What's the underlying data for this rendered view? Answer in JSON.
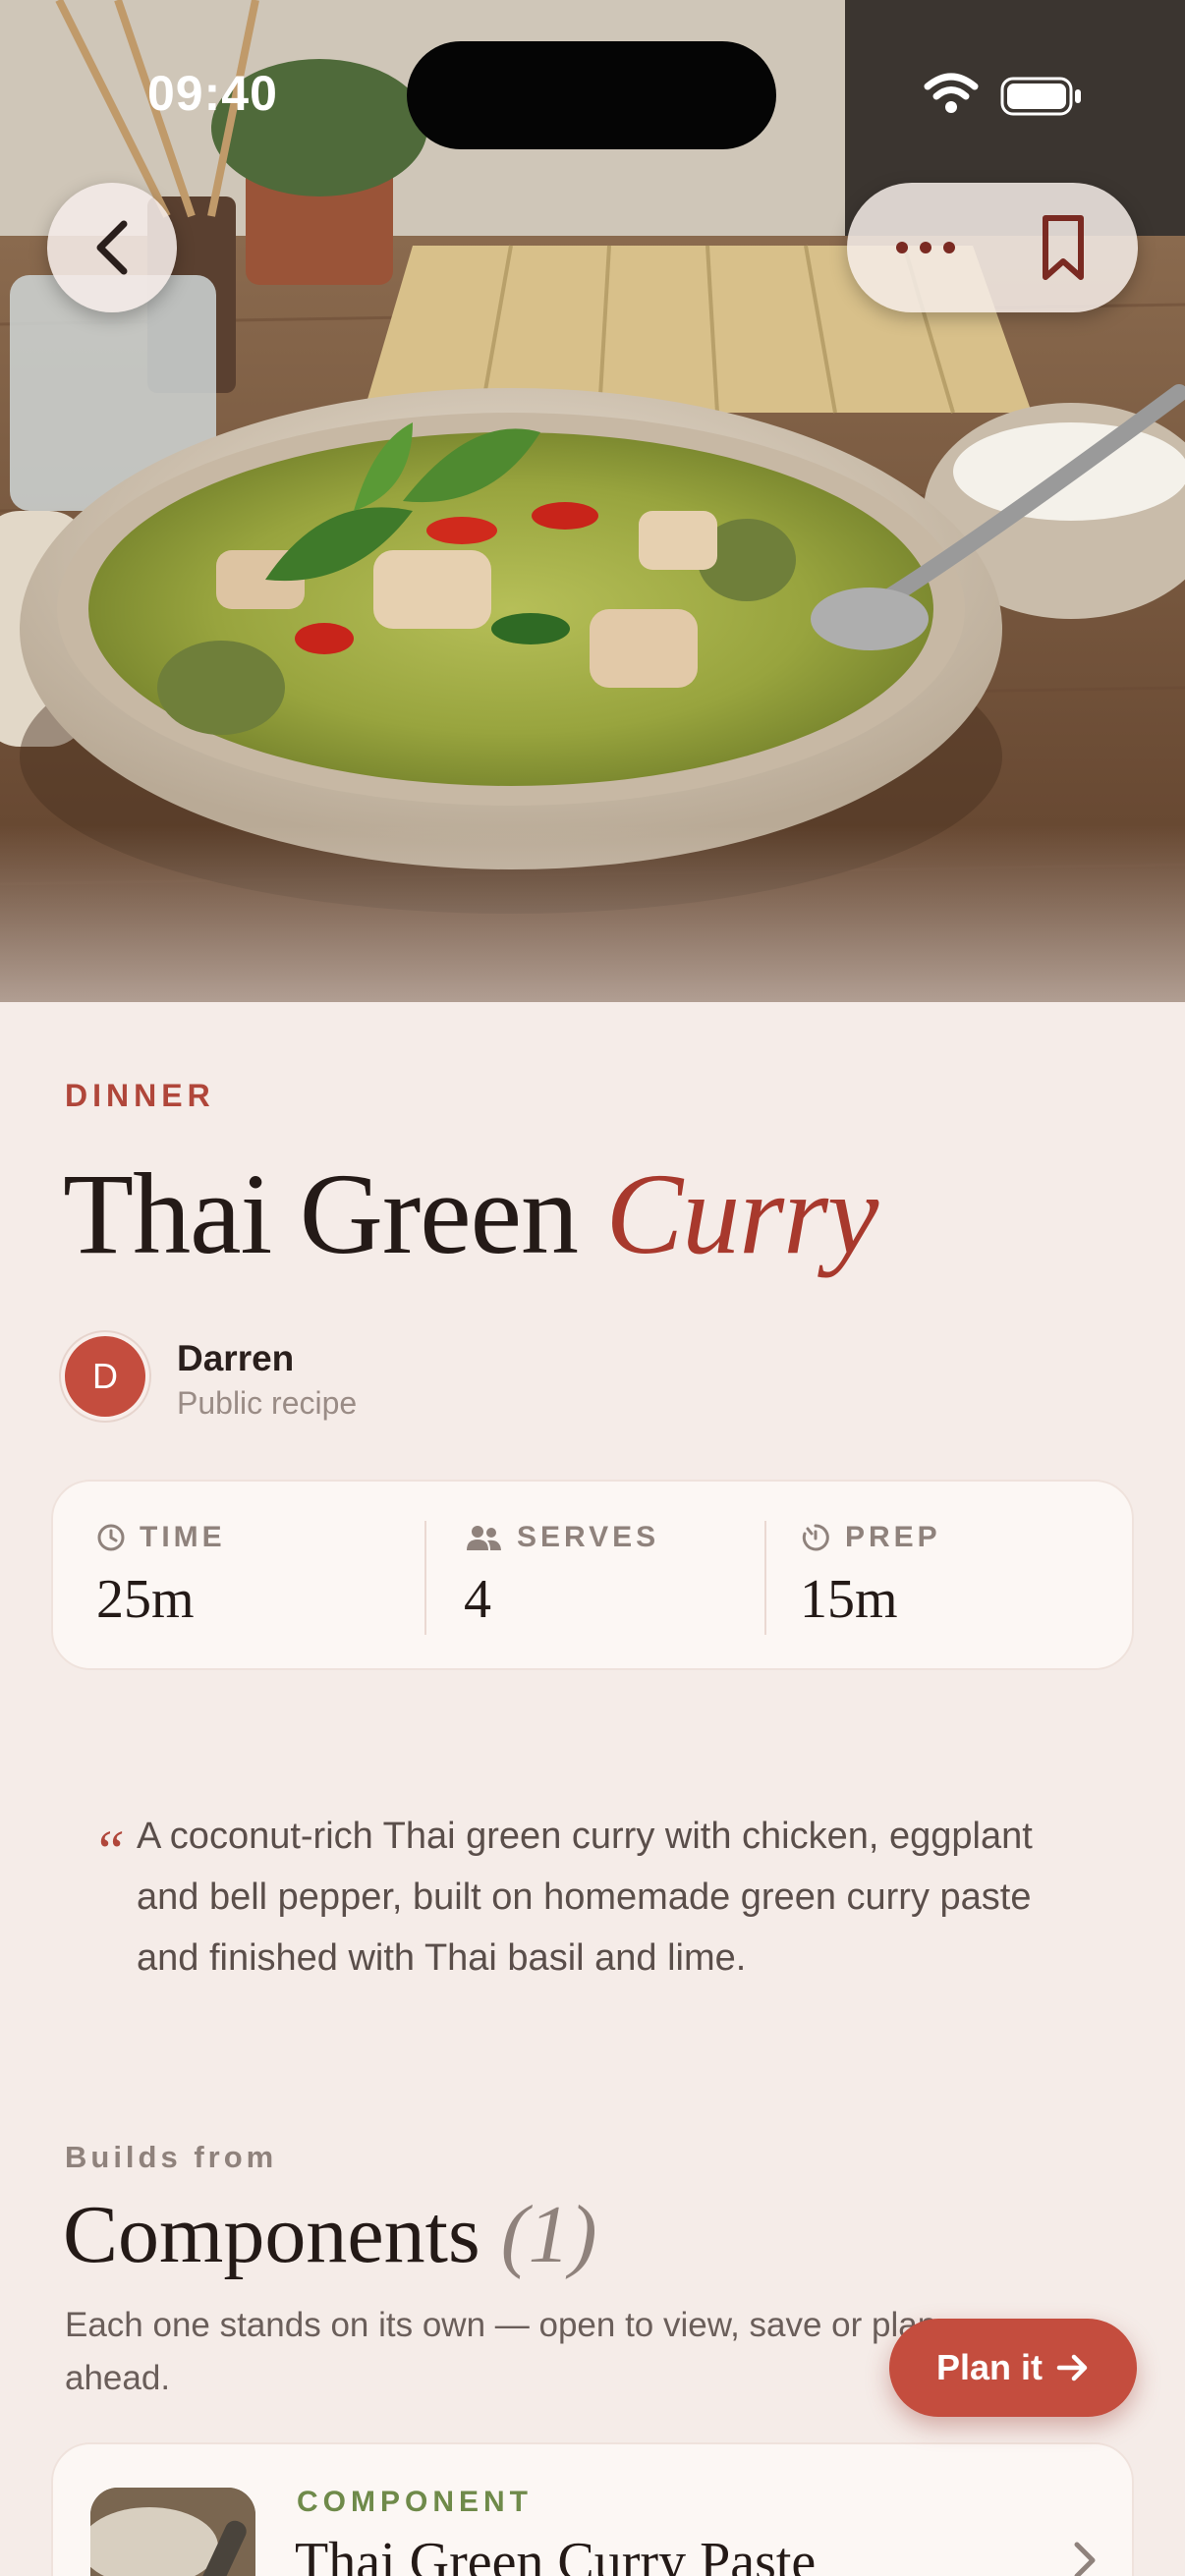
{
  "status_bar": {
    "time": "09:40"
  },
  "hero": {
    "image_alt": "Thai green curry in a ceramic bowl on a wooden table"
  },
  "recipe": {
    "category": "DINNER",
    "title_main": "Thai Green",
    "title_accent": "Curry",
    "author": {
      "initial": "D",
      "name": "Darren",
      "visibility": "Public recipe"
    },
    "stats": [
      {
        "label": "TIME",
        "value": "25m",
        "icon": "clock-icon"
      },
      {
        "label": "SERVES",
        "value": "4",
        "icon": "people-icon"
      },
      {
        "label": "PREP",
        "value": "15m",
        "icon": "timer-icon"
      }
    ],
    "quote_mark": "“",
    "description": "A coconut-rich Thai green curry with chicken, eggplant and bell pepper, built on homemade green curry paste and finished with Thai basil and lime."
  },
  "components": {
    "eyebrow": "Builds from",
    "title": "Components",
    "count": "(1)",
    "description": "Each one stands on its own — open to view, save or plan ahead.",
    "items": [
      {
        "tag": "COMPONENT",
        "name": "Thai Green Curry Paste"
      }
    ]
  },
  "fab": {
    "label": "Plan it",
    "icon": "arrow-right-icon"
  },
  "colors": {
    "accent": "#c44d3e",
    "background": "#f5ece8",
    "component_tag": "#6f8a4a"
  }
}
